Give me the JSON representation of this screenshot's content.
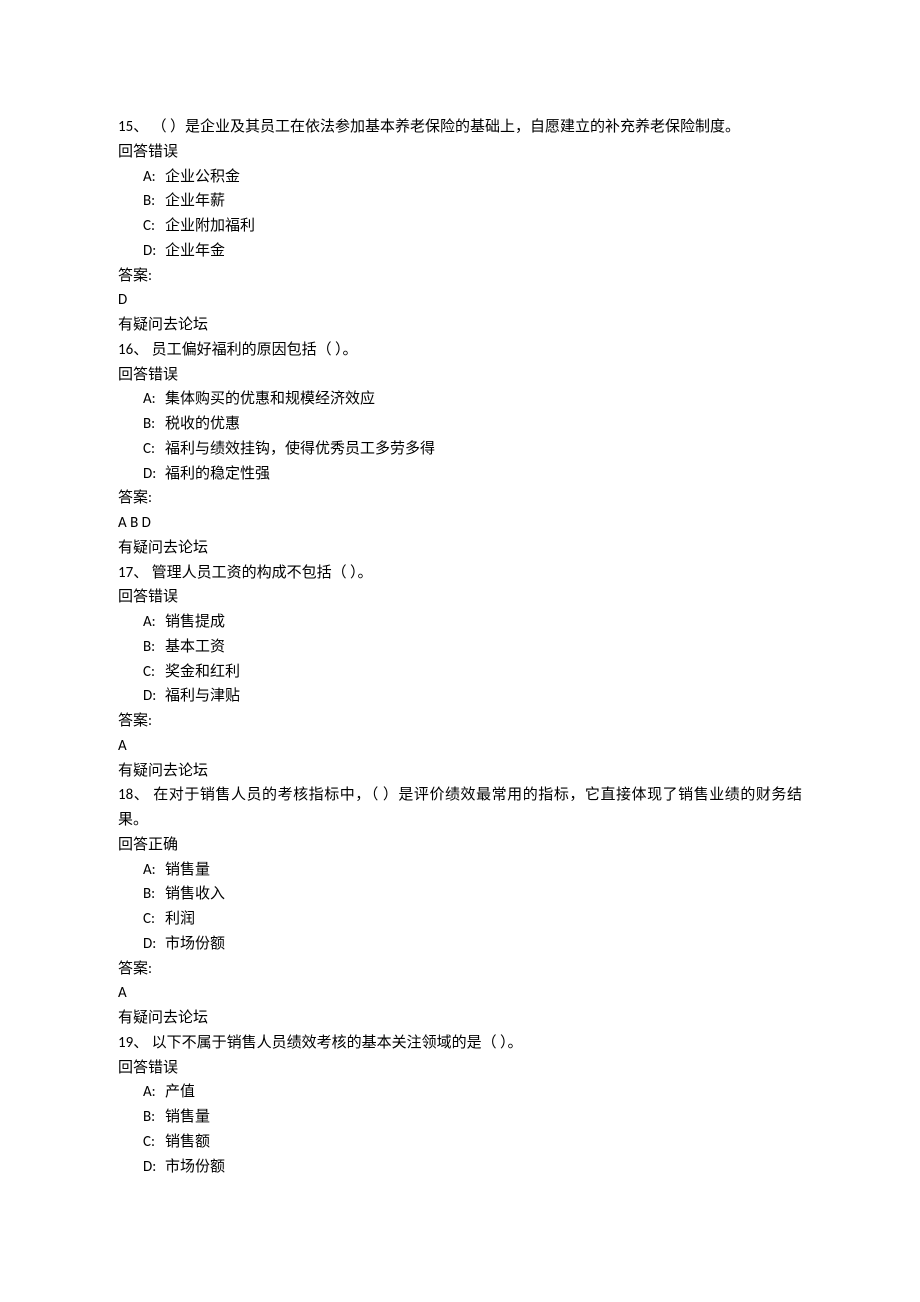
{
  "labels": {
    "answer": "答案:",
    "forum": "有疑问去论坛",
    "fb_wrong": "回答错误",
    "fb_right": "回答正确"
  },
  "questions": [
    {
      "num": "15、",
      "stem": "（  ）是企业及其员工在依法参加基本养老保险的基础上，自愿建立的补充养老保险制度。",
      "feedback": "fb_wrong",
      "options": [
        {
          "label": "A:",
          "text": "企业公积金"
        },
        {
          "label": "B:",
          "text": "企业年薪"
        },
        {
          "label": "C:",
          "text": "企业附加福利"
        },
        {
          "label": "D:",
          "text": "企业年金"
        }
      ],
      "answer": "D",
      "show_forum": true
    },
    {
      "num": "16、",
      "stem": "员工偏好福利的原因包括（  ）。",
      "feedback": "fb_wrong",
      "options": [
        {
          "label": "A:",
          "text": "集体购买的优惠和规模经济效应"
        },
        {
          "label": "B:",
          "text": "税收的优惠"
        },
        {
          "label": "C:",
          "text": "福利与绩效挂钩，使得优秀员工多劳多得"
        },
        {
          "label": "D:",
          "text": "福利的稳定性强"
        }
      ],
      "answer": "A B D",
      "show_forum": true
    },
    {
      "num": "17、",
      "stem": "管理人员工资的构成不包括（  ）。",
      "feedback": "fb_wrong",
      "options": [
        {
          "label": "A:",
          "text": "销售提成"
        },
        {
          "label": "B:",
          "text": "基本工资"
        },
        {
          "label": "C:",
          "text": "奖金和红利"
        },
        {
          "label": "D:",
          "text": "福利与津贴"
        }
      ],
      "answer": "A",
      "show_forum": true
    },
    {
      "num": "18、",
      "stem": "在对于销售人员的考核指标中，（  ）是评价绩效最常用的指标，它直接体现了销售业绩的财务结果。",
      "feedback": "fb_right",
      "options": [
        {
          "label": "A:",
          "text": "销售量"
        },
        {
          "label": "B:",
          "text": "销售收入"
        },
        {
          "label": "C:",
          "text": "利润"
        },
        {
          "label": "D:",
          "text": "市场份额"
        }
      ],
      "answer": "A",
      "show_forum": true
    },
    {
      "num": "19、",
      "stem": "以下不属于销售人员绩效考核的基本关注领域的是（  ）。",
      "feedback": "fb_wrong",
      "options": [
        {
          "label": "A:",
          "text": "产值"
        },
        {
          "label": "B:",
          "text": "销售量"
        },
        {
          "label": "C:",
          "text": "销售额"
        },
        {
          "label": "D:",
          "text": "市场份额"
        }
      ],
      "answer": "",
      "show_forum": false
    }
  ]
}
